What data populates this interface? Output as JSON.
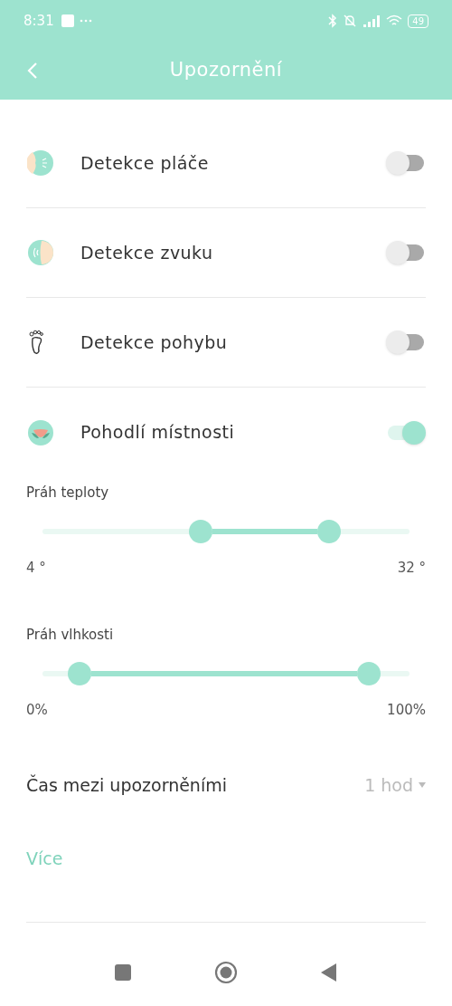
{
  "status_bar": {
    "time": "8:31",
    "battery": "49"
  },
  "header": {
    "title": "Upozornění"
  },
  "alerts": [
    {
      "kind": "cry",
      "label": "Detekce pláče",
      "on": false
    },
    {
      "kind": "sound",
      "label": "Detekce zvuku",
      "on": false
    },
    {
      "kind": "motion",
      "label": "Detekce pohybu",
      "on": false
    },
    {
      "kind": "comfort",
      "label": "Pohodlí místnosti",
      "on": true
    }
  ],
  "ranges": [
    {
      "label": "Práh teploty",
      "min_label": "4 °",
      "max_label": "32 °",
      "thumbs": [
        {
          "level": 0.43
        },
        {
          "level": 0.78
        }
      ]
    },
    {
      "label": "Práh vlhkosti",
      "min_label": "0%",
      "max_label": "100%",
      "thumbs": [
        {
          "level": 0.1
        },
        {
          "level": 0.89
        }
      ]
    }
  ],
  "interval": {
    "label": "Čas mezi upozorněními",
    "value": "1 hod"
  },
  "more_link": "Více"
}
